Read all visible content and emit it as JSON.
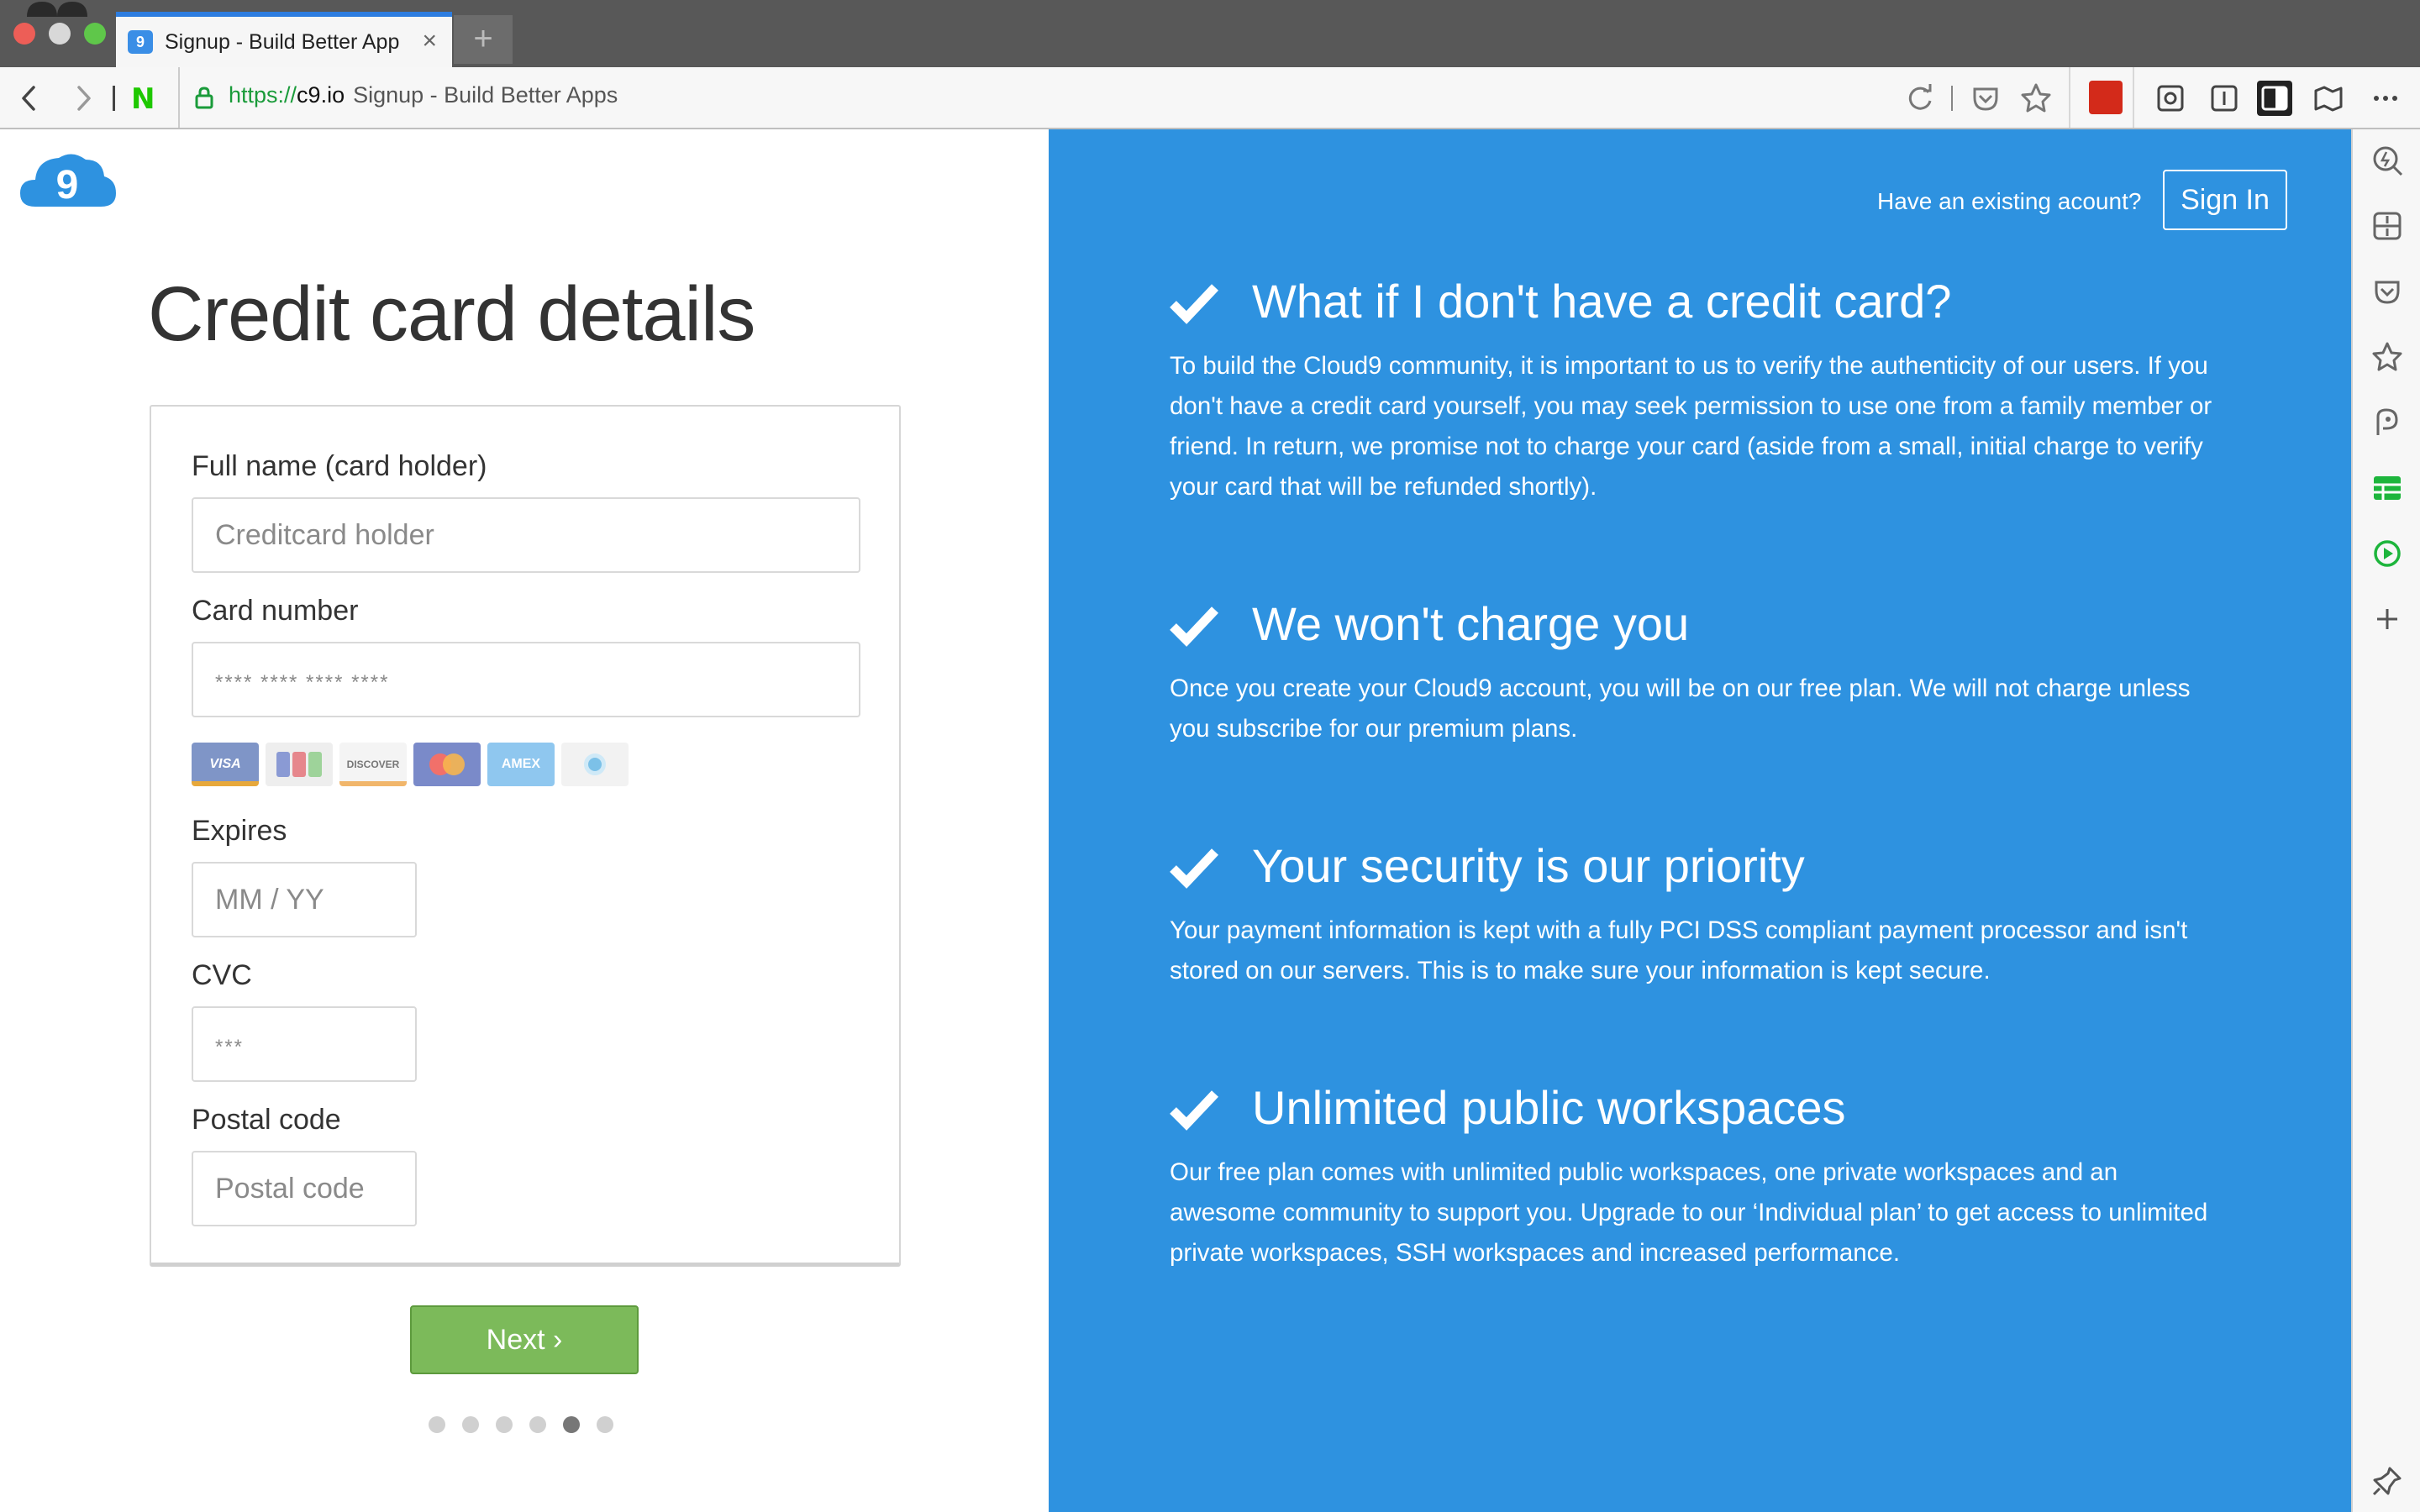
{
  "browser": {
    "tab_title": "Signup - Build Better App",
    "tab_favicon": "9",
    "tab_close": "×",
    "new_tab": "+",
    "url_scheme": "https://",
    "url_host": "c9.io",
    "url_page_title": "Signup - Build Better Apps",
    "n_logo": "N"
  },
  "left": {
    "logo": "cloud9-logo",
    "title": "Credit card details",
    "fields": {
      "name_label": "Full name (card holder)",
      "name_placeholder": "Creditcard holder",
      "number_label": "Card number",
      "number_placeholder": "**** **** **** ****",
      "expires_label": "Expires",
      "expires_placeholder": "MM / YY",
      "cvc_label": "CVC",
      "cvc_placeholder": "***",
      "postal_label": "Postal code",
      "postal_placeholder": "Postal code"
    },
    "card_brands": [
      "VISA",
      "JCB",
      "DISCOVER",
      "MASTERCARD",
      "AMEX",
      "DINERS"
    ],
    "card_labels": {
      "visa": "VISA",
      "discover": "DISCOVER",
      "amex": "AMEX"
    },
    "next_label": "Next ›",
    "steps_total": 6,
    "step_current": 5
  },
  "right": {
    "existing_text": "Have an existing acount?",
    "signin_label": "Sign In",
    "features": [
      {
        "title": "What if I don't have a credit card?",
        "body": "To build the Cloud9 community, it is important to us to verify the authenticity of our users. If you don't have a credit card yourself, you may seek permission to use one from a family member or friend. In return, we promise not to charge your card (aside from a small, initial charge to verify your card that will be refunded shortly)."
      },
      {
        "title": "We won't charge you",
        "body": "Once you create your Cloud9 account, you will be on our free plan. We will not charge unless you subscribe for our premium plans."
      },
      {
        "title": "Your security is our priority",
        "body": "Your payment information is kept with a fully PCI DSS compliant payment processor and isn't stored on our servers. This is to make sure your information is kept secure."
      },
      {
        "title": "Unlimited public workspaces",
        "body": "Our free plan comes with unlimited public workspaces, one private workspaces and an awesome community to support you. Upgrade to our ‘Individual plan’ to get access to unlimited private workspaces, SSH workspaces and increased performance."
      }
    ]
  },
  "colors": {
    "accent_blue": "#2e92e0",
    "next_green": "#7cba5a",
    "secure_green": "#1a9b3a"
  },
  "sidebar_icons": [
    "zoom-icon",
    "calculator-icon",
    "pocket-icon",
    "bookmark-star-icon",
    "papago-icon",
    "spreadsheet-icon",
    "play-icon",
    "add-icon",
    "pin-icon"
  ]
}
